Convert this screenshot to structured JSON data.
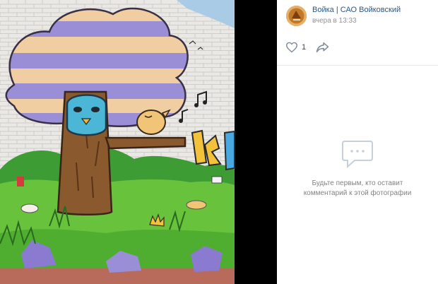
{
  "post": {
    "author_name": "Войка | САО Войковский",
    "time": "вчера в 13:33",
    "likes": "1"
  },
  "comments": {
    "empty_line1": "Будьте первым, кто оставит",
    "empty_line2": "комментарий к этой фотографии"
  },
  "icons": {
    "like": "heart-icon",
    "share": "share-arrow-icon",
    "comments": "comment-bubble-icon"
  },
  "colors": {
    "link": "#2a5885",
    "muted": "#939393",
    "icon": "#818c99"
  }
}
